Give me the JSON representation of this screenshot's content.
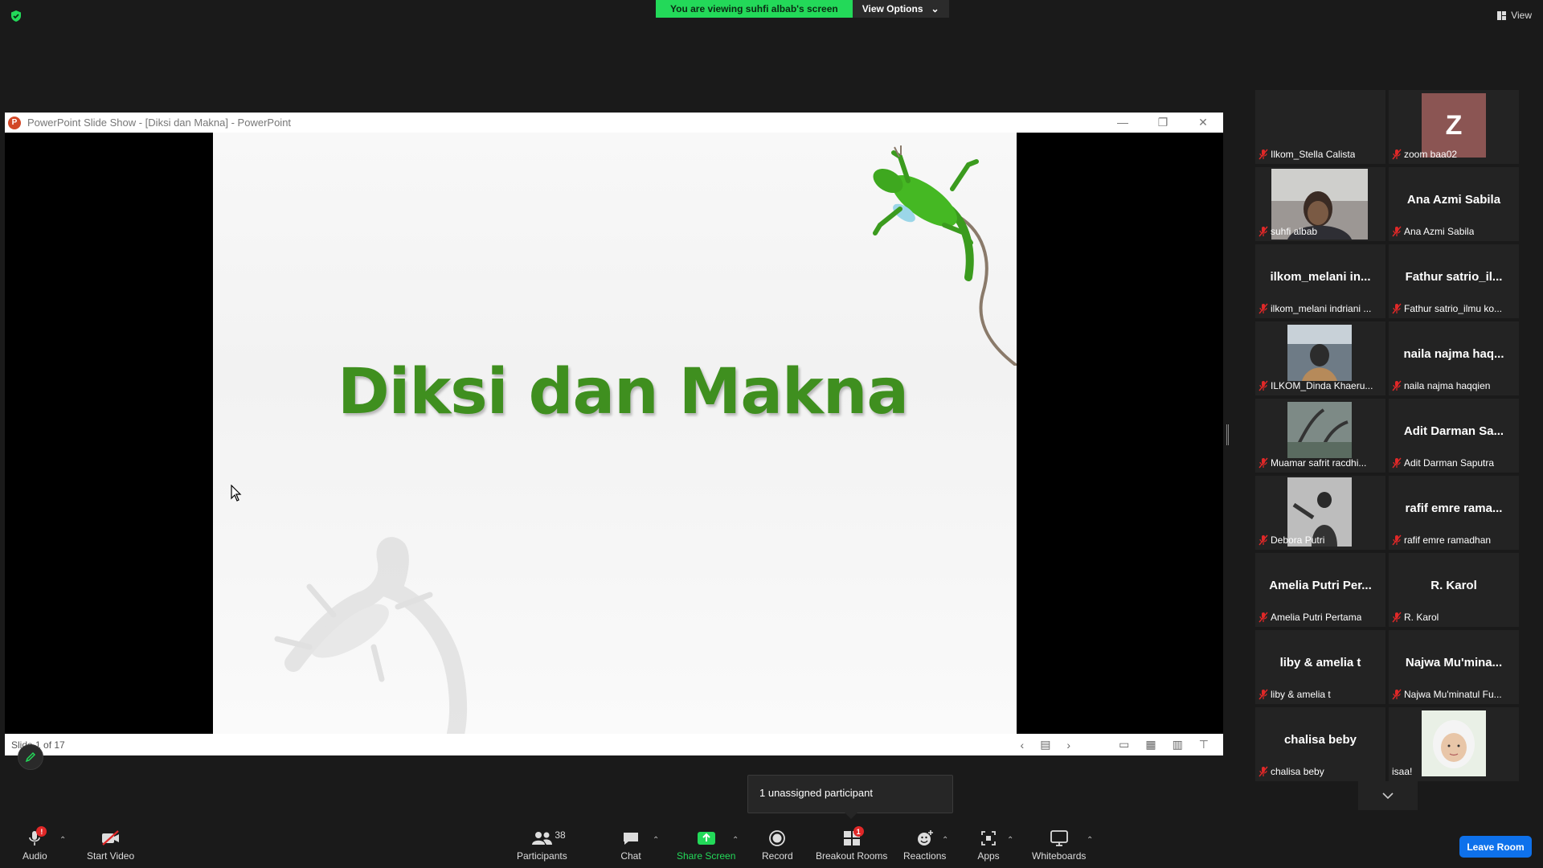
{
  "top": {
    "banner_text": "You are viewing suhfi albab's screen",
    "view_options_label": "View Options",
    "view_label": "View"
  },
  "ppt": {
    "window_title": "PowerPoint Slide Show - [Diksi dan Makna] - PowerPoint",
    "slide_title": "Diksi dan Makna",
    "slide_counter": "Slide 1 of 17"
  },
  "participants_gallery": [
    {
      "name": "",
      "label": "Ilkom_Stella Calista",
      "type": "blank"
    },
    {
      "name": "",
      "label": "zoom baa02",
      "type": "avatar",
      "avatar_letter": "Z",
      "avatar_color": "#8b5553"
    },
    {
      "name": "",
      "label": "suhfi albab",
      "type": "video"
    },
    {
      "name": "Ana Azmi Sabila",
      "label": "Ana Azmi Sabila",
      "type": "name"
    },
    {
      "name": "ilkom_melani  in...",
      "label": "ilkom_melani indriani ...",
      "type": "name"
    },
    {
      "name": "Fathur satrio_il...",
      "label": "Fathur satrio_ilmu ko...",
      "type": "name"
    },
    {
      "name": "",
      "label": "ILKOM_Dinda Khaeru...",
      "type": "photo"
    },
    {
      "name": "naila najma haq...",
      "label": "naila najma haqqien",
      "type": "name"
    },
    {
      "name": "",
      "label": "Muamar safrit racdhi...",
      "type": "photo"
    },
    {
      "name": "Adit Darman Sa...",
      "label": "Adit Darman Saputra",
      "type": "name"
    },
    {
      "name": "",
      "label": "Debora Putri",
      "type": "photo"
    },
    {
      "name": "rafif emre rama...",
      "label": "rafif emre ramadhan",
      "type": "name"
    },
    {
      "name": "Amelia Putri Per...",
      "label": "Amelia Putri Pertama",
      "type": "name"
    },
    {
      "name": "R. Karol",
      "label": "R. Karol",
      "type": "name"
    },
    {
      "name": "liby & amelia t",
      "label": "liby & amelia t",
      "type": "name"
    },
    {
      "name": "Najwa  Mu'mina...",
      "label": "Najwa Mu'minatul Fu...",
      "type": "name"
    },
    {
      "name": "chalisa beby",
      "label": "chalisa beby",
      "type": "name"
    },
    {
      "name": "",
      "label": "isaa!",
      "type": "photo"
    }
  ],
  "toast": {
    "text": "1 unassigned participant"
  },
  "toolbar": {
    "audio": "Audio",
    "audio_badge": "!",
    "start_video": "Start Video",
    "participants": "Participants",
    "participants_count": "38",
    "chat": "Chat",
    "share_screen": "Share Screen",
    "record": "Record",
    "breakout_rooms": "Breakout Rooms",
    "breakout_badge": "1",
    "reactions": "Reactions",
    "apps": "Apps",
    "whiteboards": "Whiteboards",
    "leave_room": "Leave Room"
  },
  "colors": {
    "banner_green": "#23d959",
    "leave_blue": "#0e71eb",
    "slide_title_green": "#3f8f1f",
    "mic_muted_red": "#e02828"
  }
}
